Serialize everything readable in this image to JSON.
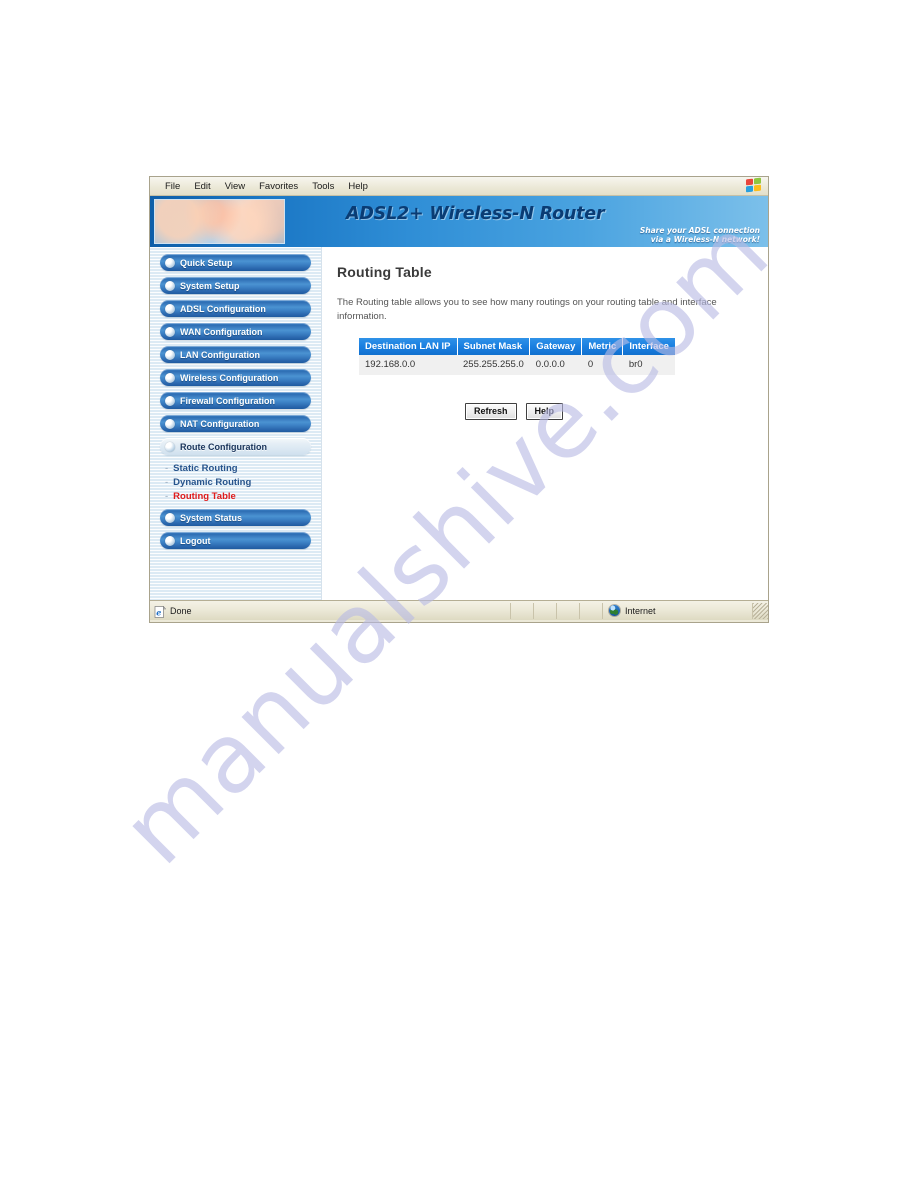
{
  "browser": {
    "menu_items": [
      {
        "label": "File"
      },
      {
        "label": "Edit"
      },
      {
        "label": "View"
      },
      {
        "label": "Favorites"
      },
      {
        "label": "Tools"
      },
      {
        "label": "Help"
      }
    ],
    "windows_flag_icon": "windows-flag-icon",
    "status": {
      "left_icon": "internet-explorer-icon",
      "left_text": "Done",
      "zone_icon": "globe-icon",
      "zone_text": "Internet"
    }
  },
  "banner": {
    "photo_alt": "router-photo-collage",
    "title": "ADSL2+ Wireless-N Router",
    "tagline_line1": "Share your ADSL connection",
    "tagline_line2": "via a Wireless-N network!"
  },
  "sidebar": {
    "items": [
      {
        "label": "Quick Setup",
        "active": false
      },
      {
        "label": "System Setup",
        "active": false
      },
      {
        "label": "ADSL Configuration",
        "active": false
      },
      {
        "label": "WAN Configuration",
        "active": false
      },
      {
        "label": "LAN Configuration",
        "active": false
      },
      {
        "label": "Wireless Configuration",
        "active": false
      },
      {
        "label": "Firewall Configuration",
        "active": false
      },
      {
        "label": "NAT Configuration",
        "active": false
      },
      {
        "label": "Route Configuration",
        "active": true
      }
    ],
    "sub_items": [
      {
        "label": "Static Routing",
        "current": false
      },
      {
        "label": "Dynamic Routing",
        "current": false
      },
      {
        "label": "Routing Table",
        "current": true
      }
    ],
    "items_after": [
      {
        "label": "System Status",
        "active": false
      },
      {
        "label": "Logout",
        "active": false
      }
    ]
  },
  "main": {
    "title": "Routing Table",
    "description": "The Routing table allows you to see how many routings on your routing table and interface information.",
    "table": {
      "columns": [
        "Destination LAN IP",
        "Subnet Mask",
        "Gateway",
        "Metric",
        "Interface"
      ],
      "rows": [
        [
          "192.168.0.0",
          "255.255.255.0",
          "0.0.0.0",
          "0",
          "br0"
        ]
      ]
    },
    "buttons": [
      {
        "label": "Refresh"
      },
      {
        "label": "Help"
      }
    ]
  },
  "watermark": {
    "text": "manualshive.com"
  },
  "colors": {
    "banner_blue": "#1a76c4",
    "table_header_blue": "#1a7fe0",
    "nav_button_blue": "#3b7fc4",
    "sub_link_blue": "#27548c",
    "active_link_red": "#e01b1b",
    "chrome_beige": "#ece9d8",
    "watermark_violet": "#b9bbe4"
  }
}
